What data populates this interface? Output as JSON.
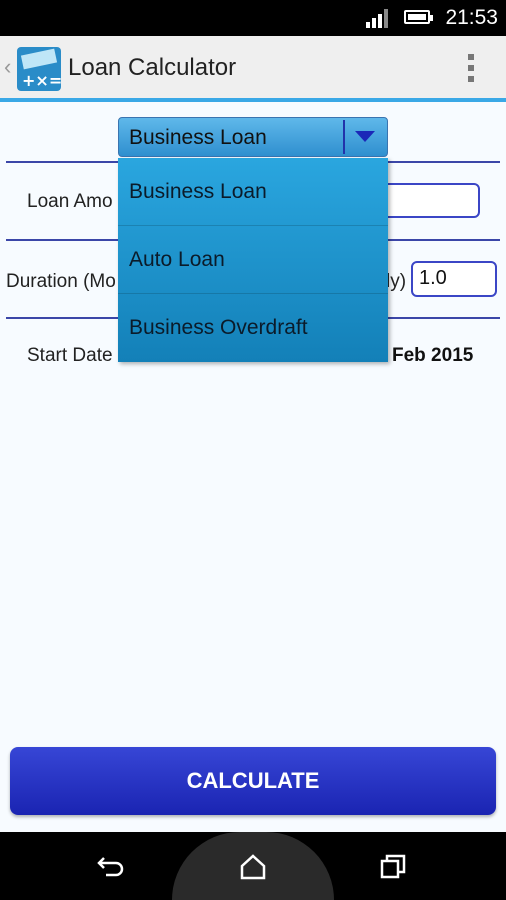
{
  "status_bar": {
    "time": "21:53",
    "signal_icon": "signal-icon",
    "battery_icon": "battery-icon",
    "battery_level": 0.8
  },
  "action_bar": {
    "title": "Loan Calculator",
    "back_icon": "chevron-left-icon",
    "app_icon": "calculator-icon",
    "overflow_icon": "overflow-menu-icon"
  },
  "spinner": {
    "selected": "Business Loan",
    "arrow_icon": "dropdown-arrow-icon"
  },
  "dropdown": {
    "options": [
      "Business Loan",
      "Auto Loan",
      "Business Overdraft"
    ]
  },
  "form": {
    "loan_amount_label": "Loan Amo",
    "loan_amount_value": "",
    "duration_label_left": "Duration (Mo",
    "duration_label_right": "ly)",
    "duration_value": "1.0",
    "start_date_label": "Start Date",
    "start_date_value": "Feb 2015"
  },
  "calculate_label": "CALCULATE",
  "nav_bar": {
    "back_icon": "back-icon",
    "home_icon": "home-icon",
    "recents_icon": "recents-icon"
  },
  "colors": {
    "accent": "#3aa8e6",
    "button": "#2630c4",
    "dropdown": "#1e95cf"
  }
}
